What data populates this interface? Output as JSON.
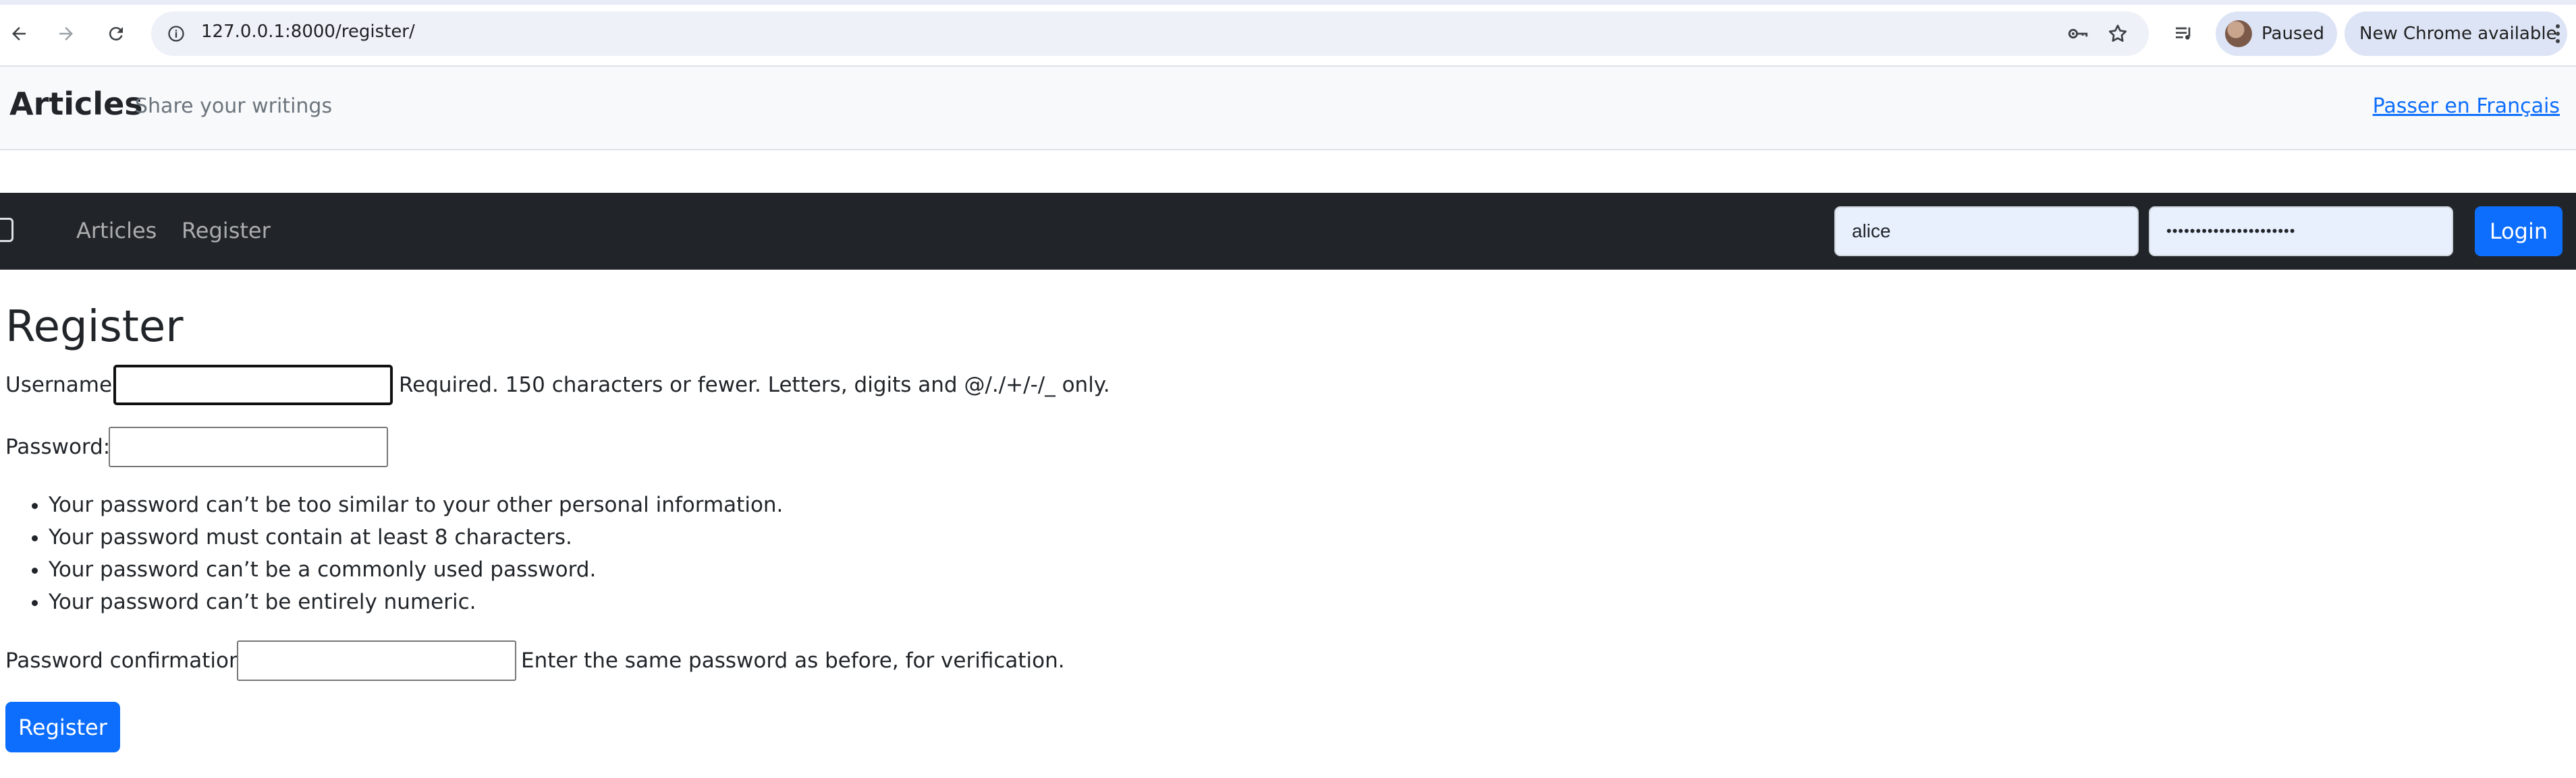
{
  "browser": {
    "url": "127.0.0.1:8000/register/",
    "profile_status": "Paused",
    "update_label": "New Chrome available"
  },
  "header": {
    "brand": "Articles",
    "tagline": "Share your writings",
    "language_link": "Passer en Français"
  },
  "navbar": {
    "links": [
      "Articles",
      "Register"
    ],
    "username_value": "alice",
    "password_value": "••••••••••••••••••••••",
    "login_label": "Login"
  },
  "main": {
    "title": "Register",
    "username_label": "Username:",
    "username_help": "Required. 150 characters or fewer. Letters, digits and @/./+/-/_ only.",
    "password_label": "Password:",
    "password_rules": [
      "Your password can’t be too similar to your other personal information.",
      "Your password must contain at least 8 characters.",
      "Your password can’t be a commonly used password.",
      "Your password can’t be entirely numeric."
    ],
    "confirm_label": "Password confirmation:",
    "confirm_help": "Enter the same password as before, for verification.",
    "submit_label": "Register"
  },
  "colors": {
    "primary": "#0d6efd",
    "navbar_bg": "#212529",
    "header_bg": "#f8f9fa"
  },
  "icons": [
    "back-arrow-icon",
    "forward-arrow-icon",
    "reload-icon",
    "site-info-icon",
    "password-key-icon",
    "bookmark-star-icon",
    "media-queue-icon",
    "more-vert-icon",
    "navbar-toggler-icon"
  ]
}
